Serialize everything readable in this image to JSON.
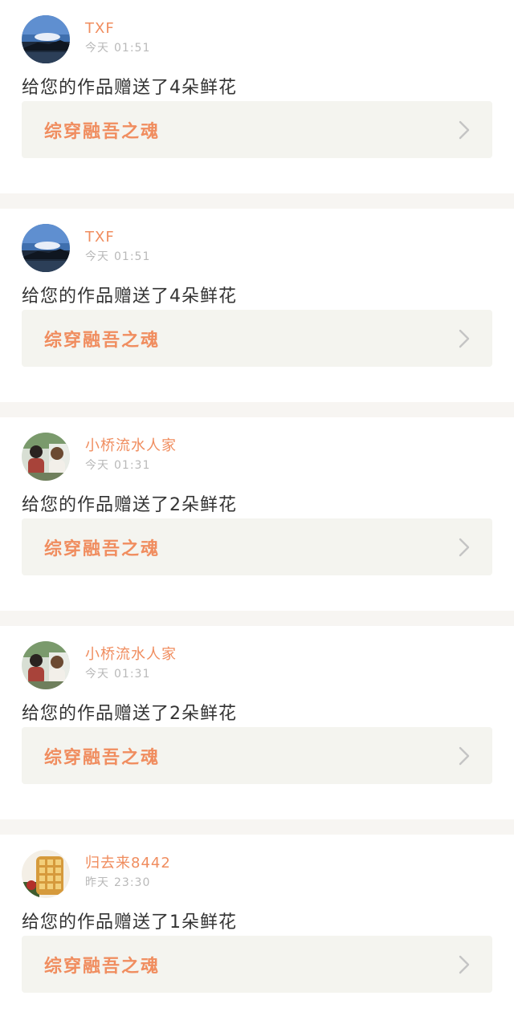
{
  "notifications": [
    {
      "user": "TXF",
      "day": "今天",
      "time": "01:51",
      "message": "给您的作品赠送了4朵鲜花",
      "work_title": "综穿融吾之魂",
      "avatar": "sea-landscape"
    },
    {
      "user": "TXF",
      "day": "今天",
      "time": "01:51",
      "message": "给您的作品赠送了4朵鲜花",
      "work_title": "综穿融吾之魂",
      "avatar": "sea-landscape"
    },
    {
      "user": "小桥流水人家",
      "day": "今天",
      "time": "01:31",
      "message": "给您的作品赠送了2朵鲜花",
      "work_title": "综穿融吾之魂",
      "avatar": "couple-photo"
    },
    {
      "user": "小桥流水人家",
      "day": "今天",
      "time": "01:31",
      "message": "给您的作品赠送了2朵鲜花",
      "work_title": "综穿融吾之魂",
      "avatar": "couple-photo"
    },
    {
      "user": "归去来8442",
      "day": "昨天",
      "time": "23:30",
      "message": "给您的作品赠送了1朵鲜花",
      "work_title": "综穿融吾之魂",
      "avatar": "waffle-food"
    }
  ],
  "colors": {
    "accent": "#f08d5f",
    "text": "#333333",
    "muted": "#b9b9b9",
    "link_bg": "#f4f4ef",
    "separator": "#f7f5f2"
  },
  "icons": {
    "chevron": "chevron-right-icon"
  }
}
